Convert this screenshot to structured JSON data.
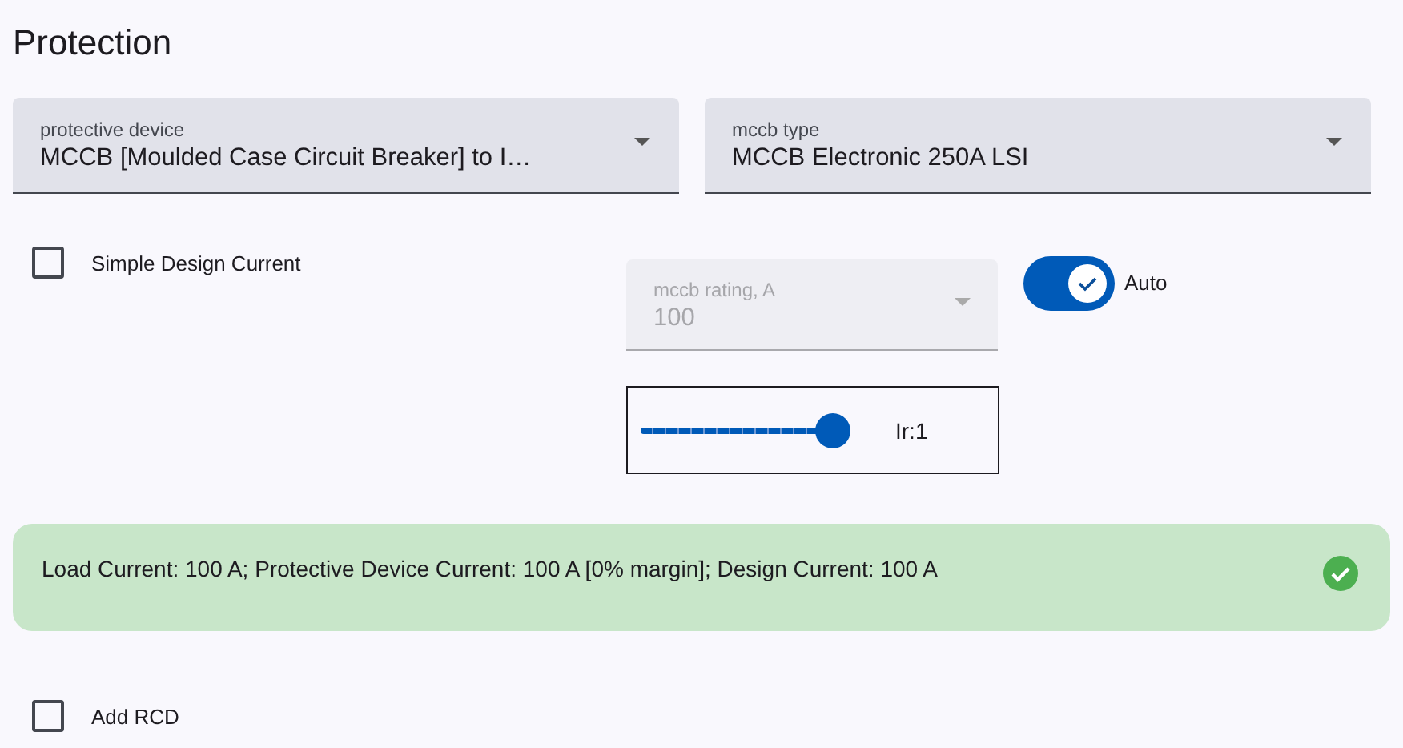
{
  "title": "Protection",
  "selects": [
    {
      "label": "protective device",
      "value": "MCCB [Moulded Case Circuit Breaker] to I…"
    },
    {
      "label": "mccb type",
      "value": "MCCB Electronic 250A LSI"
    }
  ],
  "simple_design_current": {
    "label": "Simple Design Current",
    "checked": false
  },
  "rating": {
    "label": "mccb rating, A",
    "value": "100",
    "disabled": true
  },
  "auto_switch": {
    "label": "Auto",
    "on": true
  },
  "ir_slider": {
    "level": 1,
    "reading": "Ir:1"
  },
  "alert": {
    "kind": "success",
    "text": "Load Current: 100 A; Protective Device Current: 100 A [0% margin]; Design Current: 100 A"
  },
  "add_rcd": {
    "label": "Add RCD",
    "checked": false
  }
}
